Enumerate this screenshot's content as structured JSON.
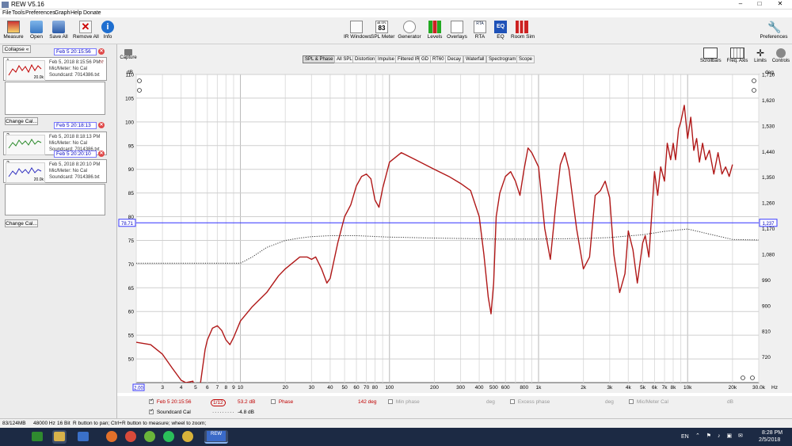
{
  "window": {
    "title": "REW V5.16"
  },
  "menu": [
    "File",
    "Tools",
    "Preferences",
    "Graph",
    "Help",
    "Donate"
  ],
  "toolbar_left": [
    {
      "label": "Measure",
      "icon": "measure-icon"
    },
    {
      "label": "Open",
      "icon": "folder-open-icon"
    },
    {
      "label": "Save All",
      "icon": "save-all-icon"
    },
    {
      "label": "Remove All",
      "icon": "remove-all-icon"
    },
    {
      "label": "Info",
      "icon": "info-icon"
    }
  ],
  "toolbar_center": [
    {
      "label": "IR Windows",
      "icon": "ir-windows-icon"
    },
    {
      "label": "SPL Meter",
      "icon": "spl-meter-icon",
      "display_top": "dB SPL",
      "display_value": "83"
    },
    {
      "label": "Generator",
      "icon": "generator-icon"
    },
    {
      "label": "Levels",
      "icon": "levels-icon"
    },
    {
      "label": "Overlays",
      "icon": "overlays-icon"
    },
    {
      "label": "RTA",
      "icon": "rta-icon",
      "icon_text": "RTA"
    },
    {
      "label": "EQ",
      "icon": "eq-icon",
      "icon_text": "EQ"
    },
    {
      "label": "Room Sim",
      "icon": "room-sim-icon"
    }
  ],
  "toolbar_right": {
    "label": "Preferences",
    "icon": "preferences-icon"
  },
  "left_panel": {
    "collapse_label": "Collapse",
    "change_cal_label": "Change Cal...",
    "measurements": [
      {
        "num": "1",
        "title": "Feb 5 20:15:56",
        "date": "Feb 5, 2018 8:15:56 PM",
        "mic": "Mic/Meter: No Cal",
        "soundcard": "Soundcard: 7014386.txt",
        "thumb_label": "20.0k",
        "color": "#c00000"
      },
      {
        "num": "2",
        "title": "Feb 5 20:18:13",
        "date": "Feb 5, 2018 8:18:13 PM",
        "mic": "Mic/Meter: No Cal",
        "soundcard": "Soundcard: 7014386.txt",
        "thumb_label": "20.0k",
        "color": "#2a8a2a"
      },
      {
        "num": "3",
        "title": "Feb 5 20:20:10",
        "date": "Feb 5, 2018 8:20:10 PM",
        "mic": "Mic/Meter: No Cal",
        "soundcard": "Soundcard: 7014386.txt",
        "thumb_label": "20.0k",
        "color": "#3030c0"
      }
    ]
  },
  "capture_label": "Capture",
  "graph_tabs": [
    "SPL & Phase",
    "All SPL",
    "Distortion",
    "Impulse",
    "Filtered IR",
    "GD",
    "RT60",
    "Decay",
    "Waterfall",
    "Spectrogram",
    "Scope"
  ],
  "selected_tab": "SPL & Phase",
  "graph_controls": [
    {
      "label": "Scrollbars",
      "icon": "scrollbars-icon"
    },
    {
      "label": "Freq. Axis",
      "icon": "freq-axis-icon"
    },
    {
      "label": "Limits",
      "icon": "limits-icon"
    },
    {
      "label": "Controls",
      "icon": "controls-icon"
    }
  ],
  "chart_data": {
    "type": "line",
    "xscale": "log",
    "xlim": [
      2,
      30000
    ],
    "ylim": [
      45,
      110
    ],
    "y2lim": [
      630,
      1710
    ],
    "ylabel": "dB",
    "y2label": "deg",
    "xlabel": "Hz",
    "grid": true,
    "x_tick_labels": [
      {
        "v": 2,
        "t": "2.00"
      },
      {
        "v": 3,
        "t": "3"
      },
      {
        "v": 4,
        "t": "4"
      },
      {
        "v": 5,
        "t": "5"
      },
      {
        "v": 6,
        "t": "6"
      },
      {
        "v": 7,
        "t": "7"
      },
      {
        "v": 8,
        "t": "8"
      },
      {
        "v": 9,
        "t": "9"
      },
      {
        "v": 10,
        "t": "10"
      },
      {
        "v": 20,
        "t": "20"
      },
      {
        "v": 30,
        "t": "30"
      },
      {
        "v": 40,
        "t": "40"
      },
      {
        "v": 50,
        "t": "50"
      },
      {
        "v": 60,
        "t": "60"
      },
      {
        "v": 70,
        "t": "70"
      },
      {
        "v": 80,
        "t": "80"
      },
      {
        "v": 100,
        "t": "100"
      },
      {
        "v": 200,
        "t": "200"
      },
      {
        "v": 300,
        "t": "300"
      },
      {
        "v": 400,
        "t": "400"
      },
      {
        "v": 500,
        "t": "500"
      },
      {
        "v": 600,
        "t": "600"
      },
      {
        "v": 800,
        "t": "800"
      },
      {
        "v": 1000,
        "t": "1k"
      },
      {
        "v": 2000,
        "t": "2k"
      },
      {
        "v": 3000,
        "t": "3k"
      },
      {
        "v": 4000,
        "t": "4k"
      },
      {
        "v": 5000,
        "t": "5k"
      },
      {
        "v": 6000,
        "t": "6k"
      },
      {
        "v": 7000,
        "t": "7k"
      },
      {
        "v": 8000,
        "t": "8k"
      },
      {
        "v": 10000,
        "t": "10k"
      },
      {
        "v": 20000,
        "t": "20k"
      },
      {
        "v": 30000,
        "t": "30.0k"
      }
    ],
    "y_ticks": [
      50,
      55,
      60,
      65,
      70,
      75,
      80,
      85,
      90,
      95,
      100,
      105,
      110
    ],
    "y2_ticks": [
      720,
      810,
      900,
      990,
      1080,
      1170,
      1260,
      1350,
      1440,
      1530,
      1620,
      1710
    ],
    "cursor": {
      "y": 78.71,
      "label": "78.71",
      "y2_label": "1,237"
    },
    "x_cursor_label": "2.00",
    "series": [
      {
        "name": "Feb 5 20:15:56",
        "color": "#b01818",
        "x": [
          2,
          2.5,
          3,
          3.5,
          4,
          4.3,
          4.8,
          5,
          5.4,
          5.8,
          6,
          6.5,
          7,
          7.5,
          8,
          8.5,
          9,
          10,
          12,
          15,
          18,
          20,
          25,
          28,
          30,
          32,
          35,
          38,
          40,
          45,
          50,
          55,
          60,
          65,
          70,
          75,
          80,
          85,
          90,
          100,
          120,
          150,
          200,
          250,
          300,
          350,
          400,
          430,
          460,
          480,
          500,
          520,
          550,
          600,
          650,
          700,
          750,
          800,
          850,
          900,
          1000,
          1100,
          1200,
          1300,
          1400,
          1500,
          1600,
          1800,
          2000,
          2200,
          2400,
          2600,
          2800,
          3000,
          3200,
          3500,
          3800,
          4000,
          4300,
          4600,
          5000,
          5200,
          5500,
          5800,
          6000,
          6300,
          6600,
          7000,
          7300,
          7700,
          8000,
          8300,
          8700,
          9000,
          9500,
          10000,
          10500,
          11000,
          11500,
          12000,
          12600,
          13200,
          14000,
          15000,
          16000,
          17000,
          18000,
          19000,
          20000
        ],
        "y": [
          53.5,
          53,
          51,
          48,
          45.5,
          45,
          45.3,
          42,
          45,
          52,
          54,
          56.5,
          57,
          56,
          54,
          53,
          54.5,
          58,
          61,
          64,
          67.5,
          69,
          71.5,
          71.5,
          71,
          71.5,
          69,
          66,
          67,
          74.5,
          80,
          82.5,
          86.5,
          88.5,
          89,
          88,
          83.5,
          82,
          86,
          91.5,
          93.5,
          92,
          90,
          88.5,
          87,
          85.5,
          80,
          72,
          63,
          59.5,
          66,
          80,
          85,
          88.5,
          89.5,
          87.5,
          84.5,
          90,
          94.5,
          93.5,
          90.5,
          77.5,
          71,
          82,
          91,
          93.5,
          90,
          77.5,
          69,
          71.5,
          84.5,
          85.5,
          87.5,
          84,
          72,
          64,
          68,
          77,
          73,
          66,
          74.5,
          76,
          71.5,
          82.5,
          89.5,
          84.5,
          90.5,
          87.5,
          95.5,
          92,
          95.5,
          92,
          98.5,
          100,
          103.5,
          96.5,
          101,
          94,
          96.5,
          91.5,
          95.5,
          92,
          94,
          89,
          93.5,
          89,
          90.5,
          88.5,
          91
        ]
      },
      {
        "name": "Soundcard Cal",
        "color": "#333333",
        "dashed": true,
        "x": [
          2,
          4,
          10,
          12,
          15,
          20,
          25,
          30,
          40,
          60,
          100,
          200,
          500,
          1000,
          2000,
          3000,
          5000,
          7000,
          10000,
          20000,
          30000
        ],
        "y": [
          70.2,
          70.2,
          70.2,
          71.5,
          73.5,
          75,
          75.5,
          75.8,
          76,
          76,
          75.7,
          75.5,
          75.3,
          75.3,
          75.4,
          75.6,
          76.2,
          76.9,
          77.4,
          75.2,
          75.1
        ]
      }
    ]
  },
  "legend": {
    "rows": [
      [
        {
          "text": "Feb 5 20:15:56",
          "color": "#c00000",
          "checked": true
        },
        {
          "text": "1/12",
          "color": "#c00000"
        },
        {
          "text": "53.2 dB",
          "color": "#c00000"
        },
        {
          "text": "Phase",
          "color": "#c00000",
          "checked": false
        },
        {
          "text": "142 deg",
          "color": "#c00000"
        },
        {
          "text": "Min phase",
          "color": "#999999",
          "checked": false
        },
        {
          "text": "deg",
          "color": "#999999"
        },
        {
          "text": "Excess phase",
          "color": "#999999",
          "checked": false
        },
        {
          "text": "deg",
          "color": "#999999"
        },
        {
          "text": "Mic/Meter Cal",
          "color": "#999999",
          "checked": false
        },
        {
          "text": "dB",
          "color": "#999999"
        }
      ],
      [
        {
          "text": "Soundcard Cal",
          "color": "#000000",
          "checked": true
        },
        {
          "text": "-4.8 dB",
          "color": "#000000"
        }
      ]
    ]
  },
  "status": {
    "memory": "83/124MB",
    "rate": "48000 Hz",
    "bits": "16 Bit",
    "hint": "R button to pan; Ctrl+R button to measure; wheel to zoom;"
  },
  "taskbar": {
    "lang": "EN",
    "time": "8:28 PM",
    "date": "2/5/2018",
    "active_app_label": "REW",
    "apps": [
      {
        "name": "nvidia-icon",
        "color": "#2f8a2f"
      },
      {
        "name": "file-explorer-icon",
        "color": "#d8b24a"
      },
      {
        "name": "store-icon",
        "color": "#3a70c8"
      },
      {
        "name": "firefox-icon",
        "color": "#e2702a"
      },
      {
        "name": "chrome-icon",
        "color": "#d84a3a"
      },
      {
        "name": "utorrent-icon",
        "color": "#6ab43a"
      },
      {
        "name": "spotify-icon",
        "color": "#2abf5a"
      },
      {
        "name": "chrome-2-icon",
        "color": "#d8b23a"
      },
      {
        "name": "rew-app-icon",
        "color": "#3a6ac8"
      }
    ]
  }
}
